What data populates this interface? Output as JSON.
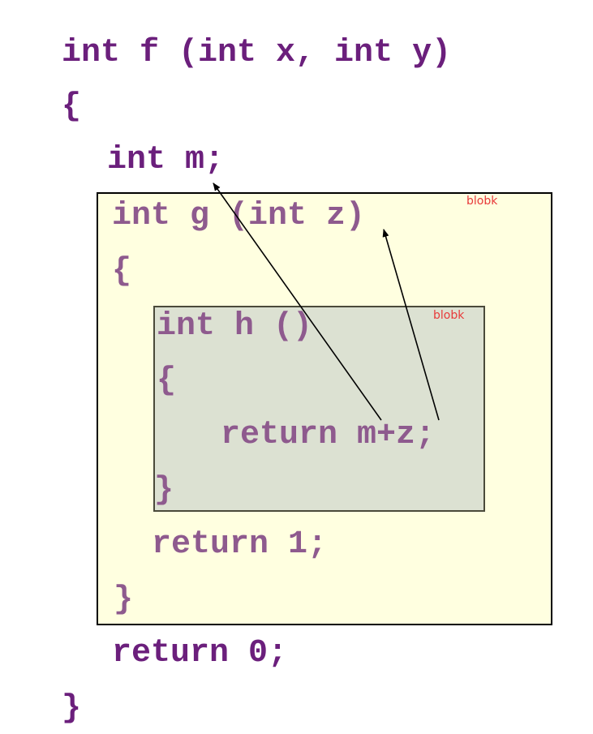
{
  "colors": {
    "code_outer": "#6b1f7c",
    "code_inner": "#8e5a8e",
    "block_outer_fill": "#ffffe0",
    "block_inner_fill": "#dce1d2",
    "block_label": "#e83a3a",
    "arrow": "#000000"
  },
  "code": {
    "f_signature": "int f (int x, int y)",
    "f_open": "{",
    "f_decl_m": "int m;",
    "g_signature": "int g (int z)",
    "g_open": "{",
    "h_signature": "int h ()",
    "h_open": "{",
    "h_return": "return m+z;",
    "h_close": "}",
    "g_return": "return 1;",
    "g_close": "}",
    "f_return": "return 0;",
    "f_close": "}"
  },
  "blocks": {
    "outer_label": "blobk",
    "inner_label": "blobk"
  },
  "arrows": [
    {
      "from": "m in return m+z",
      "to": "declaration int m"
    },
    {
      "from": "z in return m+z",
      "to": "parameter z of g"
    }
  ]
}
